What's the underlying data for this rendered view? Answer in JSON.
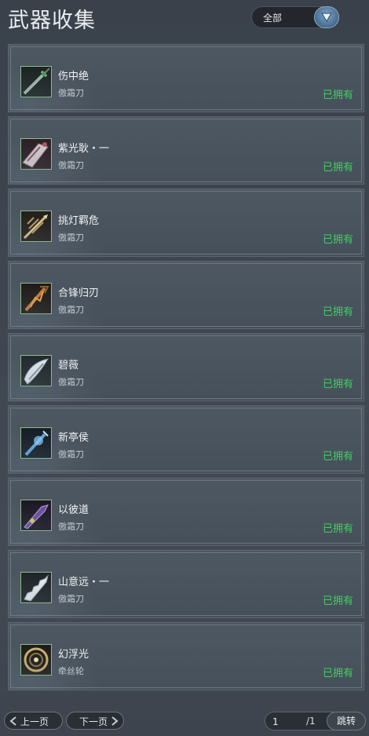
{
  "header": {
    "title": "武器收集",
    "filter_value": "全部"
  },
  "weapons": [
    {
      "name": "伤中绝",
      "category": "傲霜刀",
      "status": "已拥有",
      "icon": "green-sword-icon"
    },
    {
      "name": "紫光耿・一",
      "category": "傲霜刀",
      "status": "已拥有",
      "icon": "silver-broadblade-icon"
    },
    {
      "name": "挑灯羁危",
      "category": "傲霜刀",
      "status": "已拥有",
      "icon": "golden-spike-sword-icon"
    },
    {
      "name": "合锋归刃",
      "category": "傲霜刀",
      "status": "已拥有",
      "icon": "bronze-flame-sword-icon"
    },
    {
      "name": "碧薇",
      "category": "傲霜刀",
      "status": "已拥有",
      "icon": "white-wing-blade-icon"
    },
    {
      "name": "新亭侯",
      "category": "傲霜刀",
      "status": "已拥有",
      "icon": "blue-crystal-sword-icon"
    },
    {
      "name": "以彼道",
      "category": "傲霜刀",
      "status": "已拥有",
      "icon": "purple-blade-icon"
    },
    {
      "name": "山意远・一",
      "category": "傲霜刀",
      "status": "已拥有",
      "icon": "white-jagged-blade-icon"
    },
    {
      "name": "幻浮光",
      "category": "牵丝轮",
      "status": "已拥有",
      "icon": "golden-ring-wheel-icon"
    }
  ],
  "pagination": {
    "prev_label": "上一页",
    "next_label": "下一页",
    "current_page": "1",
    "total_pages": "/1",
    "jump_label": "跳转"
  },
  "colors": {
    "owned": "#3fcf61",
    "accent": "#6f9cc3"
  }
}
